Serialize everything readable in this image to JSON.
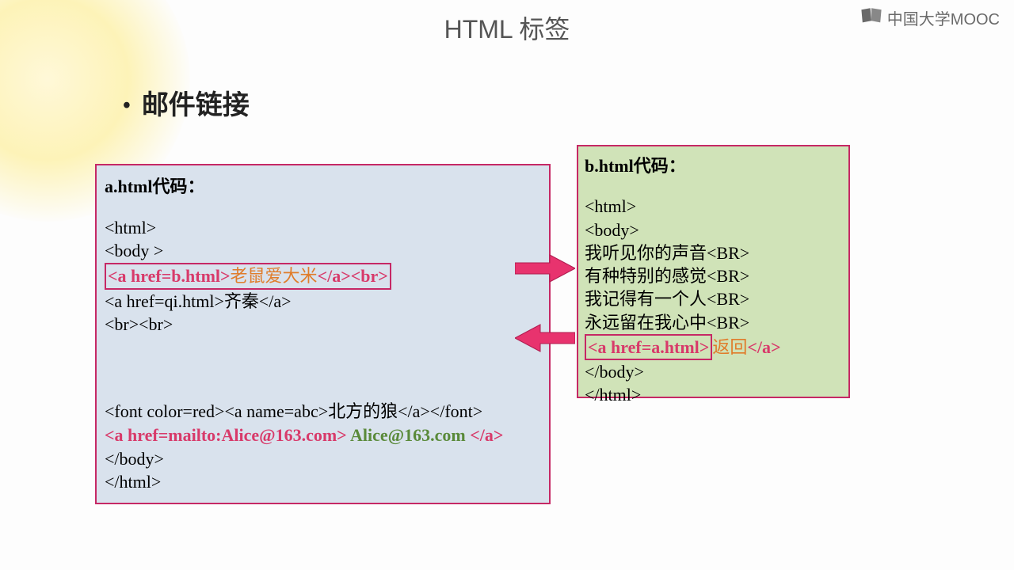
{
  "slide": {
    "title": "HTML 标签",
    "logo_text": "中国大学MOOC",
    "heading": "邮件链接"
  },
  "box_a": {
    "title": "a.html代码：",
    "l1": "<html>",
    "l2": "<body >",
    "hl_open": "<a href=b.html>",
    "hl_text": "老鼠爱大米",
    "hl_close": "</a><br>",
    "l4": "<a href=qi.html>齐秦</a>",
    "l5": "<br><br>",
    "l6": "<font color=red><a name=abc>北方的狼</a></font>",
    "mailto_open": "<a href=mailto:Alice@163.com>",
    "mailto_text": " Alice@163.com ",
    "mailto_close": "</a>",
    "l8": "</body>",
    "l9": "</html>"
  },
  "box_b": {
    "title": "b.html代码：",
    "l1": "<html>",
    "l2": "<body>",
    "l3": "我听见你的声音<BR>",
    "l4": "有种特别的感觉<BR>",
    "l5": "我记得有一个人<BR>",
    "l6": "永远留在我心中<BR>",
    "hl_open": "<a href=a.html>",
    "hl_text": "返回",
    "hl_close": "</a>",
    "l8": "</body>",
    "l9": "</html>"
  }
}
